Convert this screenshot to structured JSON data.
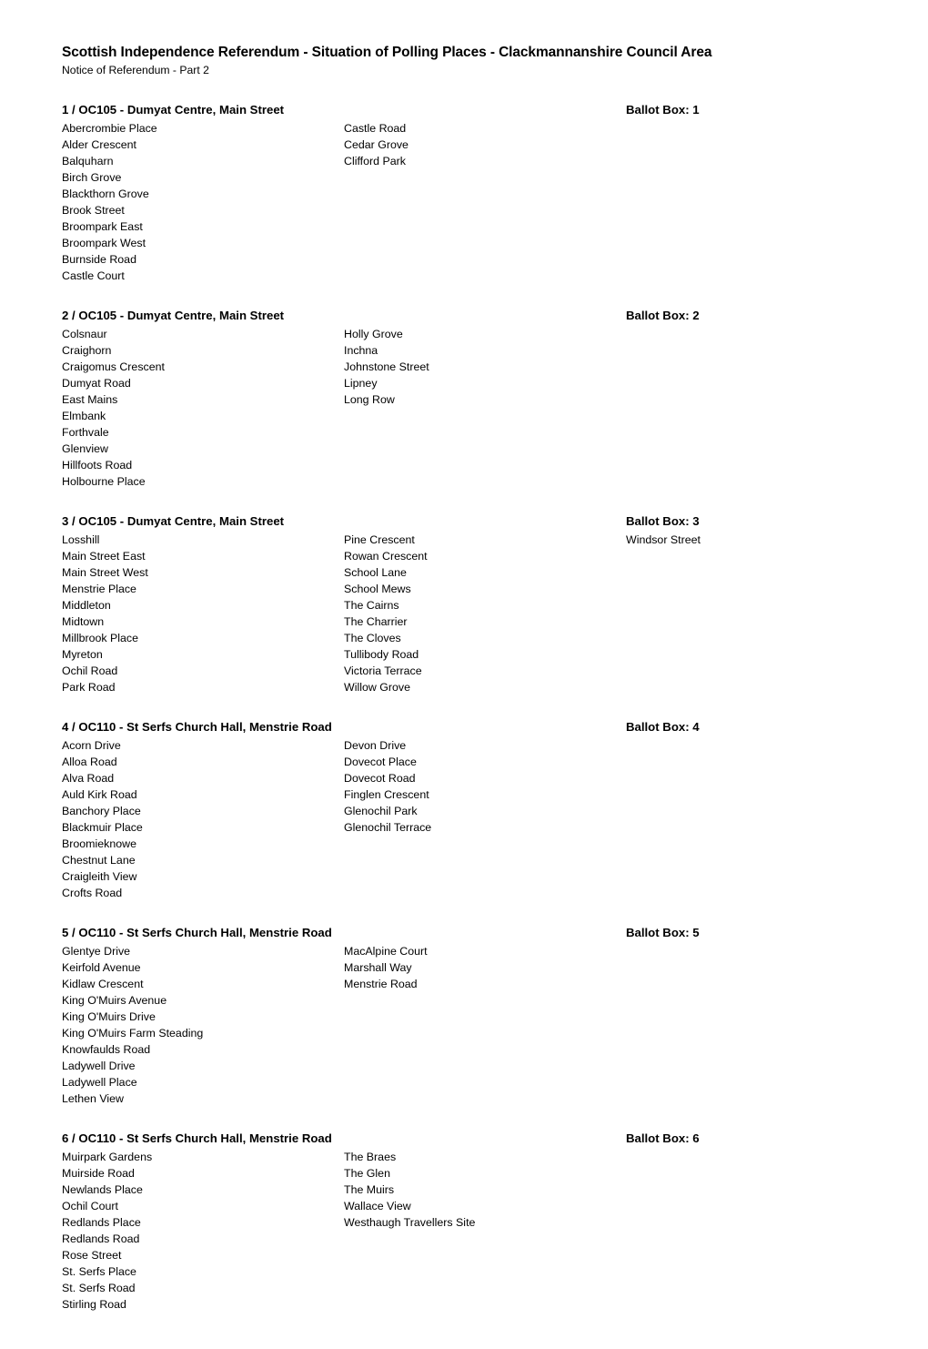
{
  "document": {
    "title": "Scottish Independence Referendum - Situation of Polling Places - Clackmannanshire Council Area",
    "subtitle": "Notice of Referendum - Part 2"
  },
  "sections": [
    {
      "heading": "1 / OC105 - Dumyat Centre, Main Street",
      "ballot_box": "Ballot Box: 1",
      "columns": [
        [
          "Abercrombie Place",
          "Alder Crescent",
          "Balquharn",
          "Birch Grove",
          "Blackthorn Grove",
          "Brook Street",
          "Broompark East",
          "Broompark West",
          "Burnside Road",
          "Castle Court"
        ],
        [
          "Castle Road",
          "Cedar Grove",
          "Clifford Park"
        ],
        []
      ]
    },
    {
      "heading": "2 / OC105 - Dumyat Centre, Main Street",
      "ballot_box": "Ballot Box: 2",
      "columns": [
        [
          "Colsnaur",
          "Craighorn",
          "Craigomus Crescent",
          "Dumyat Road",
          "East Mains",
          "Elmbank",
          "Forthvale",
          "Glenview",
          "Hillfoots Road",
          "Holbourne Place"
        ],
        [
          "Holly Grove",
          "Inchna",
          "Johnstone Street",
          "Lipney",
          "Long Row"
        ],
        []
      ]
    },
    {
      "heading": "3 / OC105 - Dumyat Centre, Main Street",
      "ballot_box": "Ballot Box: 3",
      "columns": [
        [
          "Losshill",
          "Main Street East",
          "Main Street West",
          "Menstrie Place",
          "Middleton",
          "Midtown",
          "Millbrook Place",
          "Myreton",
          "Ochil Road",
          "Park Road"
        ],
        [
          "Pine Crescent",
          "Rowan Crescent",
          "School Lane",
          "School Mews",
          "The Cairns",
          "The Charrier",
          "The Cloves",
          "Tullibody Road",
          "Victoria Terrace",
          "Willow Grove"
        ],
        [
          "Windsor Street"
        ]
      ]
    },
    {
      "heading": "4 / OC110 - St Serfs Church Hall, Menstrie Road",
      "ballot_box": "Ballot Box: 4",
      "columns": [
        [
          "Acorn Drive",
          "Alloa Road",
          "Alva Road",
          "Auld Kirk Road",
          "Banchory Place",
          "Blackmuir Place",
          "Broomieknowe",
          "Chestnut Lane",
          "Craigleith View",
          "Crofts Road"
        ],
        [
          "Devon Drive",
          "Dovecot Place",
          "Dovecot Road",
          "Finglen Crescent",
          "Glenochil Park",
          "Glenochil Terrace"
        ],
        []
      ]
    },
    {
      "heading": "5 / OC110 - St Serfs Church Hall, Menstrie Road",
      "ballot_box": "Ballot Box: 5",
      "columns": [
        [
          "Glentye Drive",
          "Keirfold Avenue",
          "Kidlaw Crescent",
          "King O'Muirs Avenue",
          "King O'Muirs Drive",
          "King O'Muirs Farm Steading",
          "Knowfaulds Road",
          "Ladywell Drive",
          "Ladywell Place",
          "Lethen View"
        ],
        [
          "MacAlpine Court",
          "Marshall Way",
          "Menstrie Road"
        ],
        []
      ]
    },
    {
      "heading": "6 / OC110 - St Serfs Church Hall, Menstrie Road",
      "ballot_box": "Ballot Box: 6",
      "columns": [
        [
          "Muirpark Gardens",
          "Muirside Road",
          "Newlands Place",
          "Ochil Court",
          "Redlands Place",
          "Redlands Road",
          "Rose Street",
          "St. Serfs Place",
          "St. Serfs Road",
          "Stirling Road"
        ],
        [
          "The Braes",
          "The Glen",
          "The Muirs",
          "Wallace View",
          "Westhaugh Travellers Site"
        ],
        []
      ]
    }
  ]
}
